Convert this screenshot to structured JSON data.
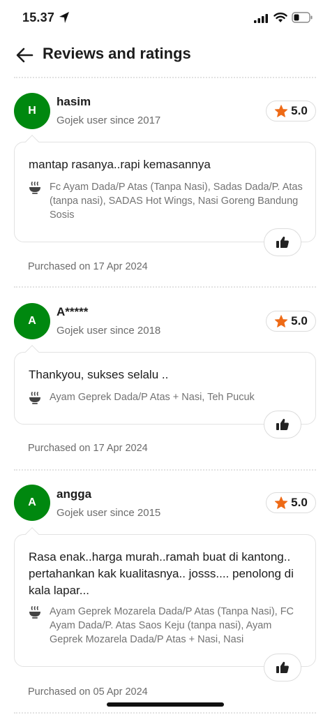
{
  "status_bar": {
    "time": "15.37"
  },
  "header": {
    "title": "Reviews and ratings"
  },
  "reviews": [
    {
      "initial": "H",
      "name": "hasim",
      "since": "Gojek user since 2017",
      "rating": "5.0",
      "comment": "mantap rasanya..rapi kemasannya",
      "items": "Fc Ayam Dada/P Atas (Tanpa Nasi), Sadas Dada/P. Atas (tanpa nasi), SADAS Hot Wings, Nasi Goreng Bandung Sosis",
      "purchased": "Purchased on 17 Apr 2024"
    },
    {
      "initial": "A",
      "name": "A*****",
      "since": "Gojek user since 2018",
      "rating": "5.0",
      "comment": "Thankyou, sukses selalu ..",
      "items": "Ayam Geprek Dada/P Atas + Nasi, Teh Pucuk",
      "purchased": "Purchased on 17 Apr 2024"
    },
    {
      "initial": "A",
      "name": "angga",
      "since": "Gojek user since 2015",
      "rating": "5.0",
      "comment": "Rasa enak..harga murah..ramah buat di kantong.. pertahankan kak kualitasnya.. josss.... penolong di kala lapar...",
      "items": "Ayam Geprek Mozarela Dada/P Atas (Tanpa Nasi), FC Ayam Dada/P. Atas Saos Keju (tanpa nasi), Ayam Geprek Mozarela Dada/P Atas + Nasi, Nasi",
      "purchased": "Purchased on 05 Apr 2024"
    }
  ],
  "colors": {
    "avatar": "#00880f",
    "star": "#ee6a16"
  }
}
